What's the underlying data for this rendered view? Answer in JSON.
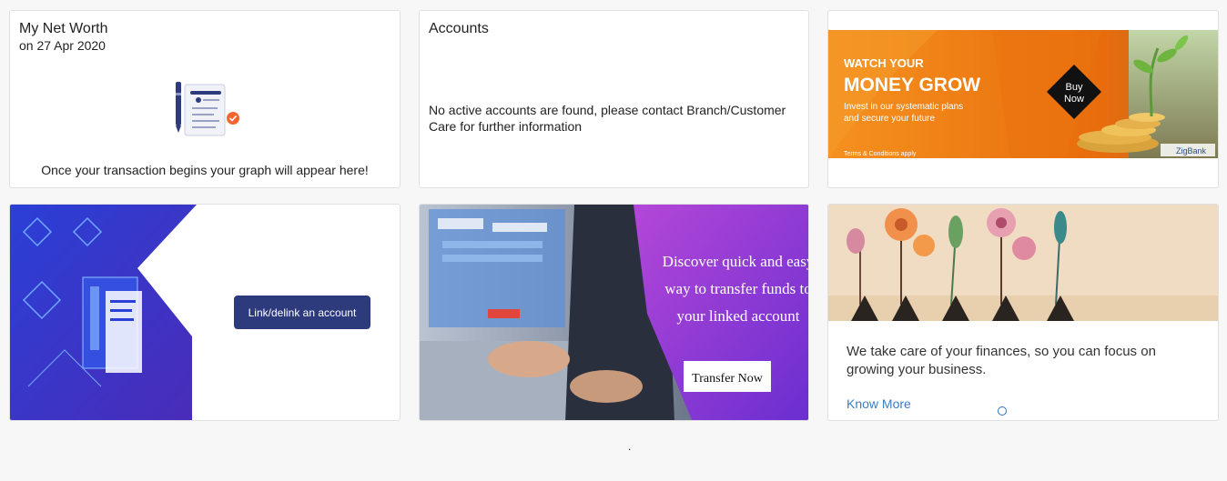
{
  "net_worth": {
    "title": "My Net Worth",
    "date": "on 27 Apr 2020",
    "empty_message": "Once your transaction begins your graph will appear here!"
  },
  "accounts": {
    "title": "Accounts",
    "message": "No active accounts are found, please contact Branch/Customer Care for further information"
  },
  "invest_banner": {
    "line1": "WATCH YOUR",
    "line2": "MONEY GROW",
    "line3": "Invest in our systematic plans",
    "line4": "and secure your future",
    "cta": "Buy\nNow",
    "terms": "Terms & Conditions apply",
    "brand": "ZigBank",
    "colors": {
      "orange": "#f08a1c",
      "dark": "#111111"
    }
  },
  "link_account": {
    "button_label": "Link/delink an account",
    "colors": {
      "blue": "#2d3a7c",
      "gradient_start": "#2a3fd6",
      "gradient_end": "#4a2cb8"
    }
  },
  "transfer_banner": {
    "headline": "Discover quick and easy way to transfer funds to your linked account",
    "cta": "Transfer Now",
    "colors": {
      "purple": "#8e2fd0"
    }
  },
  "care_card": {
    "text": "We take care of your finances, so you can focus on growing your business.",
    "link": "Know More"
  },
  "footer": {
    "marker": "."
  }
}
